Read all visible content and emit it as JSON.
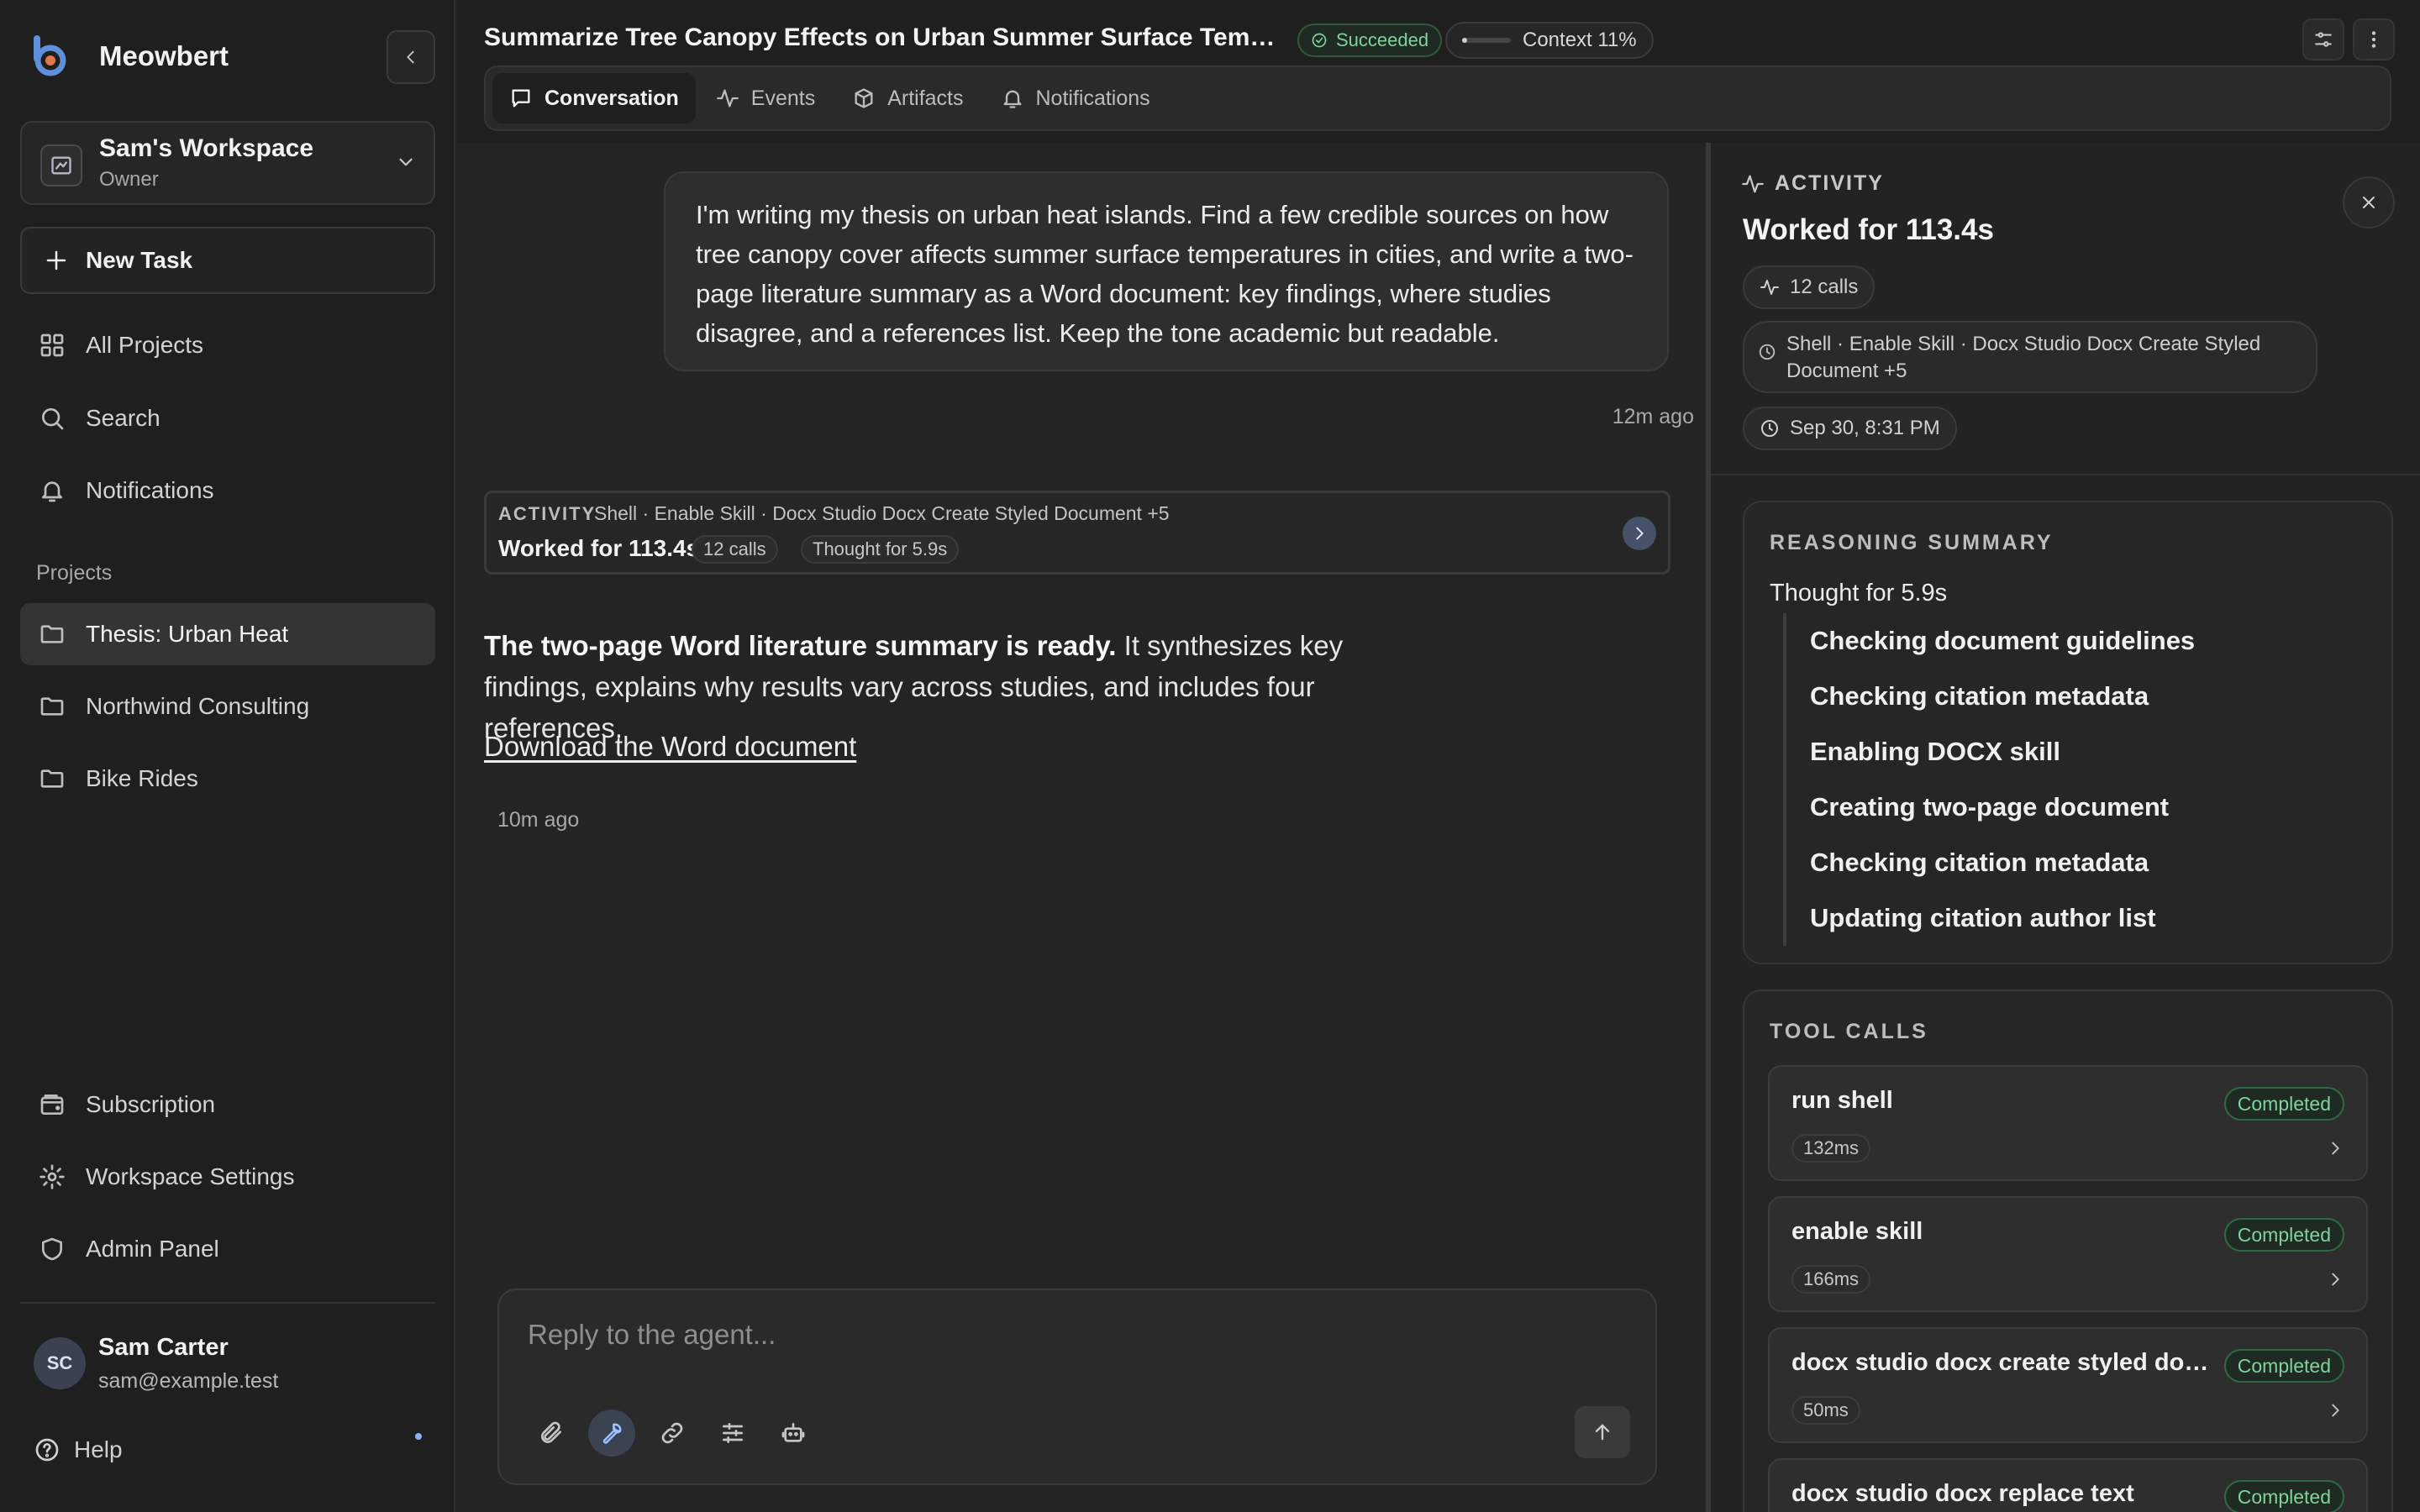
{
  "app": {
    "name": "Meowbert",
    "collapse_label": "Collapse sidebar"
  },
  "workspace": {
    "name": "Sam's Workspace",
    "role": "Owner"
  },
  "sidebar": {
    "new_task_label": "New Task",
    "nav": [
      {
        "label": "All Projects",
        "icon": "grid-icon"
      },
      {
        "label": "Search",
        "icon": "search-icon"
      },
      {
        "label": "Notifications",
        "icon": "bell-icon"
      }
    ],
    "projects_label": "Projects",
    "projects": [
      {
        "label": "Thesis: Urban Heat",
        "active": true
      },
      {
        "label": "Northwind Consulting",
        "active": false
      },
      {
        "label": "Bike Rides",
        "active": false
      }
    ],
    "bottom_nav": [
      {
        "label": "Subscription",
        "icon": "wallet-icon"
      },
      {
        "label": "Workspace Settings",
        "icon": "gear-icon"
      },
      {
        "label": "Admin Panel",
        "icon": "shield-icon"
      }
    ],
    "user": {
      "initials": "SC",
      "name": "Sam Carter",
      "email": "sam@example.test"
    },
    "help_label": "Help"
  },
  "header": {
    "title": "Summarize Tree Canopy Effects on Urban Summer Surface Temperatures",
    "status": "Succeeded",
    "context_label": "Context 11%",
    "context_fraction": 0.11,
    "tabs": [
      {
        "label": "Conversation",
        "icon": "chat-icon",
        "active": true
      },
      {
        "label": "Events",
        "icon": "activity-icon",
        "active": false
      },
      {
        "label": "Artifacts",
        "icon": "box-icon",
        "active": false
      },
      {
        "label": "Notifications",
        "icon": "bell-icon",
        "active": false
      }
    ]
  },
  "conversation": {
    "user_message": "I'm writing my thesis on urban heat islands. Find a few credible sources on how tree canopy cover affects summer surface temperatures in cities, and write a two-page literature summary as a Word document: key findings, where studies disagree, and a references list. Keep the tone academic but readable.",
    "user_message_time": "12m ago",
    "activity": {
      "label": "ACTIVITY",
      "tools": "Shell · Enable Skill · Docx Studio Docx Create Styled Document +5",
      "worked": "Worked for 113.4s",
      "calls": "12 calls",
      "thought": "Thought for 5.9s"
    },
    "reply_bold": "The two-page Word literature summary is ready.",
    "reply_rest": " It synthesizes key findings, explains why results vary across studies, and includes four references.",
    "download_link": "Download the Word document",
    "reply_time": "10m ago"
  },
  "composer": {
    "placeholder": "Reply to the agent...",
    "tools": [
      "paperclip-icon",
      "wrench-icon",
      "link-icon",
      "sliders-icon",
      "bot-icon"
    ],
    "send_icon": "arrow-up-icon"
  },
  "activity_panel": {
    "header": "ACTIVITY",
    "title": "Worked for 113.4s",
    "calls": "12 calls",
    "tools_summary": "Shell · Enable Skill · Docx Studio Docx Create Styled Document +5",
    "timestamp": "Sep 30, 8:31 PM",
    "reasoning": {
      "heading": "REASONING SUMMARY",
      "thought": "Thought for 5.9s",
      "steps": [
        "Checking document guidelines",
        "Checking citation metadata",
        "Enabling DOCX skill",
        "Creating two-page document",
        "Checking citation metadata",
        "Updating citation author list"
      ]
    },
    "tool_calls": {
      "heading": "TOOL CALLS",
      "items": [
        {
          "name": "run shell",
          "status": "Completed",
          "duration": "132ms"
        },
        {
          "name": "enable skill",
          "status": "Completed",
          "duration": "166ms"
        },
        {
          "name": "docx studio docx create styled document",
          "status": "Completed",
          "duration": "50ms"
        },
        {
          "name": "docx studio docx replace text",
          "status": "Completed",
          "duration": ""
        }
      ]
    }
  },
  "colors": {
    "background": "#232323",
    "sidebar": "#1f1f1f",
    "success": "#7fd39b",
    "accent": "#9cc2ff"
  }
}
